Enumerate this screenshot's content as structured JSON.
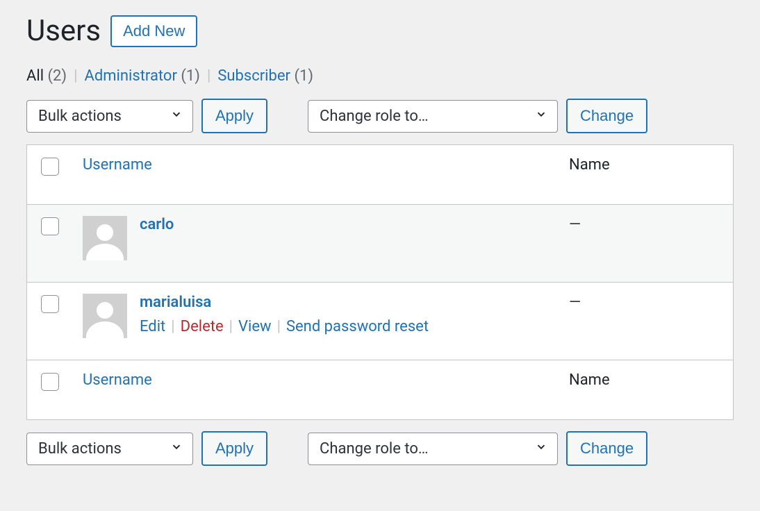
{
  "page": {
    "title": "Users",
    "add_new": "Add New"
  },
  "filters": {
    "all_label": "All",
    "all_count": "(2)",
    "admin_label": "Administrator",
    "admin_count": "(1)",
    "subscriber_label": "Subscriber",
    "subscriber_count": "(1)"
  },
  "toolbar": {
    "bulk_label": "Bulk actions",
    "apply": "Apply",
    "role_label": "Change role to…",
    "change": "Change"
  },
  "table": {
    "header_username": "Username",
    "header_name": "Name",
    "rows": [
      {
        "username": "carlo",
        "name": "—",
        "show_actions": false
      },
      {
        "username": "marialuisa",
        "name": "—",
        "show_actions": true
      }
    ],
    "actions": {
      "edit": "Edit",
      "delete": "Delete",
      "view": "View",
      "reset": "Send password reset"
    }
  }
}
